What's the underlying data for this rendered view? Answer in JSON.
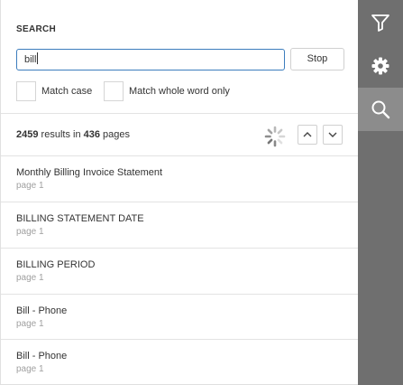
{
  "search": {
    "title": "SEARCH",
    "query": "bill",
    "stop_label": "Stop",
    "match_case_label": "Match case",
    "match_whole_word_label": "Match whole word only"
  },
  "summary": {
    "count": "2459",
    "mid": " results in ",
    "pages": "436",
    "tail": " pages"
  },
  "results": [
    {
      "title": "Monthly Billing Invoice Statement",
      "page": "page 1"
    },
    {
      "title": "BILLING STATEMENT DATE",
      "page": "page 1"
    },
    {
      "title": "BILLING PERIOD",
      "page": "page 1"
    },
    {
      "title": "Bill - Phone",
      "page": "page 1"
    },
    {
      "title": "Bill - Phone",
      "page": "page 1"
    }
  ],
  "sidebar": {
    "items": [
      {
        "icon": "filter-icon"
      },
      {
        "icon": "gear-icon"
      },
      {
        "icon": "search-icon",
        "active": true
      }
    ],
    "background": "#6f6f6f",
    "active_background": "#8c8c8c"
  },
  "colors": {
    "input_border": "#3c7dbd",
    "secondary_text": "#a0a0a0"
  }
}
